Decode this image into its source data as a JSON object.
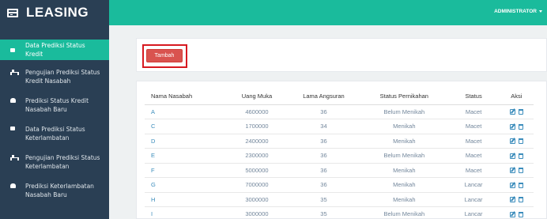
{
  "app": {
    "title": "LEASING"
  },
  "topbar": {
    "user": "ADMINISTRATOR"
  },
  "sidebar": {
    "items": [
      {
        "label": "Data Prediksi Status Kredit",
        "icon": "square-icon",
        "active": true
      },
      {
        "label": "Pengujian Prediksi Status Kredit Nasabah",
        "icon": "sitemap-icon",
        "active": false
      },
      {
        "label": "Prediksi Status Kredit Nasabah Baru",
        "icon": "car-icon",
        "active": false
      },
      {
        "label": "Data Prediksi Status Keterlambatan",
        "icon": "square-icon",
        "active": false
      },
      {
        "label": "Pengujian Prediksi Status Keterlambatan",
        "icon": "sitemap-icon",
        "active": false
      },
      {
        "label": "Prediksi Keterlambatan Nasabah Baru",
        "icon": "car-icon",
        "active": false
      }
    ]
  },
  "actions": {
    "add_label": "Tambah"
  },
  "table": {
    "headers": [
      "Nama Nasabah",
      "Uang Muka",
      "Lama Angsuran",
      "Status Pernikahan",
      "Status",
      "Aksi"
    ],
    "rows": [
      [
        "A",
        "4600000",
        "36",
        "Belum Menikah",
        "Macet"
      ],
      [
        "C",
        "1700000",
        "34",
        "Menikah",
        "Macet"
      ],
      [
        "D",
        "2400000",
        "36",
        "Menikah",
        "Macet"
      ],
      [
        "E",
        "2300000",
        "36",
        "Belum Menikah",
        "Macet"
      ],
      [
        "F",
        "5000000",
        "36",
        "Menikah",
        "Macet"
      ],
      [
        "G",
        "7000000",
        "36",
        "Menikah",
        "Lancar"
      ],
      [
        "H",
        "3000000",
        "35",
        "Menikah",
        "Lancar"
      ],
      [
        "I",
        "3000000",
        "35",
        "Belum Menikah",
        "Lancar"
      ]
    ]
  },
  "colors": {
    "brand": "#2a3f54",
    "accent": "#1abb9c",
    "danger": "#d9534f",
    "link": "#3c8dbc"
  }
}
